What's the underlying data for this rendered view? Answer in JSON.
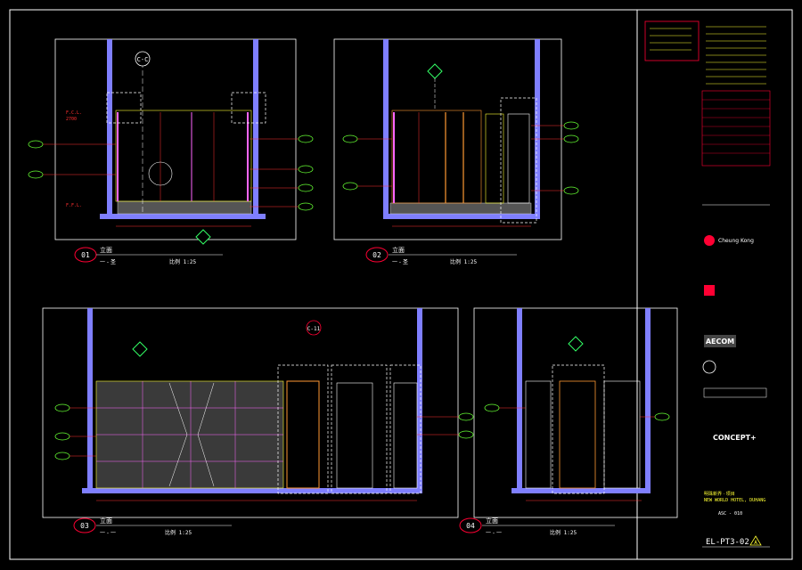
{
  "sheet": {
    "background": "#000000",
    "border_color": "#ffffff",
    "drawing_number": "EL-PT3-02",
    "revision_mark": "A"
  },
  "colors": {
    "wall": "#7f7fff",
    "line": "#ffffff",
    "dim": "#ff3030",
    "tag": "#66ff33",
    "section": "#33ff66",
    "accent": "#ffff33",
    "panel": "#ff66ff",
    "wood": "#ff9933",
    "detail": "#ff0033",
    "stone": "#bbbbbb"
  },
  "views": [
    {
      "num": "01",
      "title": "立面",
      "subtitle": "一 - 圣",
      "scale": "比例   1:25"
    },
    {
      "num": "02",
      "title": "立面",
      "subtitle": "一 - 圣",
      "scale": "比例   1:25"
    },
    {
      "num": "03",
      "title": "立面",
      "subtitle": "一 - 一",
      "scale": "比例   1:25"
    },
    {
      "num": "04",
      "title": "立面",
      "subtitle": "一 - 一",
      "scale": "比例   1:25"
    }
  ],
  "section_callouts": {
    "c_c": "C-C",
    "c_11": "C-11"
  },
  "levels": {
    "ffl": "F.F.L.",
    "fcl": "F.C.L.",
    "height": "2700"
  },
  "title_block": {
    "consultants": [
      "Cheung Kong",
      "AECOM",
      "CONCEPT+"
    ],
    "project_cn": "明珠新界 · 项目",
    "project_en": "NEW WORLD HOTEL, DUHANG",
    "scale": "ASC - 010",
    "sheet": "EL-PT3-02"
  }
}
